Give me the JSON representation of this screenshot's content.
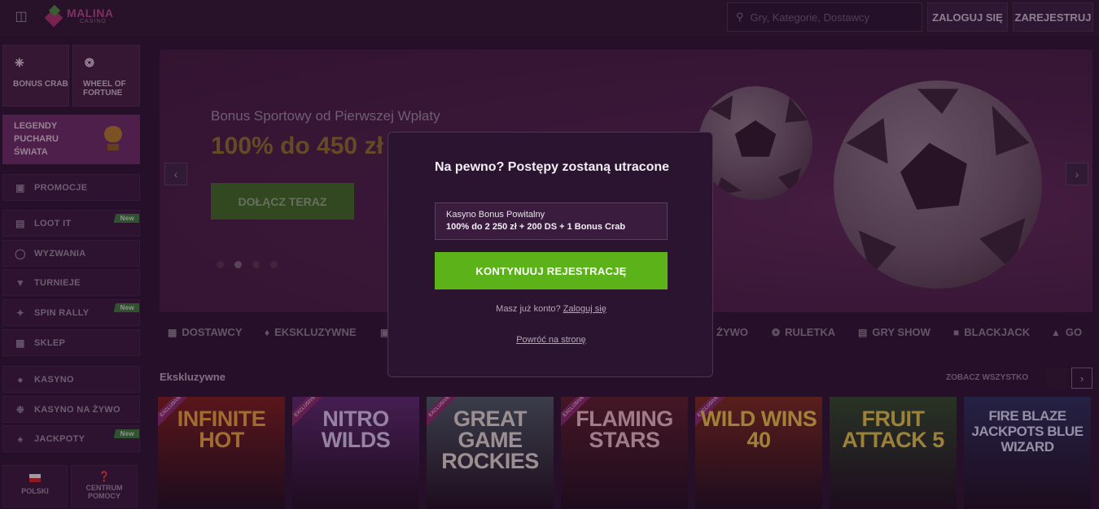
{
  "topbar": {
    "brand": "MALINA",
    "brand_sub": "CASINO",
    "search_placeholder": "Gry, Kategorie, Dostawcy",
    "login_label": "ZALOGUJ SIĘ",
    "register_label": "ZAREJESTRUJ"
  },
  "sidebar": {
    "tiles": [
      {
        "label": "BONUS CRAB",
        "icon": "crab-claw-icon"
      },
      {
        "label": "WHEEL OF FORTUNE",
        "icon": "wheel-icon"
      }
    ],
    "legend": {
      "label": "LEGENDY PUCHARU ŚWIATA",
      "icon": "trophy-icon"
    },
    "items": [
      {
        "label": "PROMOCJE",
        "icon": "gift-icon",
        "badge": ""
      },
      {
        "label": "LOOT IT",
        "icon": "chart-icon",
        "badge": "New"
      },
      {
        "label": "WYZWANIA",
        "icon": "medal-icon",
        "badge": ""
      },
      {
        "label": "TURNIEJE",
        "icon": "trophy-icon",
        "badge": ""
      },
      {
        "label": "SPIN RALLY",
        "icon": "flag-icon",
        "badge": "New"
      },
      {
        "label": "SKLEP",
        "icon": "store-icon",
        "badge": ""
      },
      {
        "label": "KASYNO",
        "icon": "dice-icon",
        "badge": ""
      },
      {
        "label": "KASYNO NA ŻYWO",
        "icon": "chip-icon",
        "badge": ""
      },
      {
        "label": "JACKPOTY",
        "icon": "crown-icon",
        "badge": "New"
      }
    ],
    "language_label": "POLSKI",
    "help_label": "CENTRUM POMOCY"
  },
  "hero": {
    "subtitle": "Bonus Sportowy od Pierwszej Wpłaty",
    "title": "100% do 450 zł",
    "cta_label": "DOŁĄCZ TERAZ",
    "prev_label": "‹",
    "next_label": "›"
  },
  "categories": [
    {
      "label": "DOSTAWCY",
      "icon": "grid-icon"
    },
    {
      "label": "EKSKLUZYWNE",
      "icon": "diamond-icon"
    },
    {
      "label": "",
      "icon": "slots-icon"
    },
    {
      "label": "ŻYWO",
      "icon": ""
    },
    {
      "label": "RULETKA",
      "icon": "roulette-icon"
    },
    {
      "label": "GRY SHOW",
      "icon": "show-icon"
    },
    {
      "label": "BLACKJACK",
      "icon": "card-icon"
    },
    {
      "label": "GO",
      "icon": "fire-icon"
    }
  ],
  "section": {
    "title": "Ekskluzywne",
    "see_all": "ZOBACZ WSZYSTKO",
    "next_label": "›"
  },
  "games": [
    {
      "title": "INFINITE HOT",
      "badge": "EXCLUSIVE",
      "color": "#7a1e1a",
      "text_color": "#e8a23a"
    },
    {
      "title": "NITRO WILDS",
      "badge": "EXCLUSIVE",
      "color": "#5b2a6e",
      "text_color": "#d7c3ea"
    },
    {
      "title": "GREAT GAME ROCKIES",
      "badge": "EXCLUSIVE",
      "color": "#4b5a63",
      "text_color": "#e0d8cf"
    },
    {
      "title": "FLAMING STARS",
      "badge": "EXCLUSIVE",
      "color": "#5a1f2a",
      "text_color": "#e8b9c0"
    },
    {
      "title": "WILD WINS 40",
      "badge": "EXCLUSIVE",
      "color": "#7a2a1c",
      "text_color": "#e8c24a"
    },
    {
      "title": "FRUIT ATTACK 5",
      "badge": "",
      "color": "#2f4a2a",
      "text_color": "#e0c24a"
    },
    {
      "title": "FIRE BLAZE JACKPOTS BLUE WIZARD",
      "badge": "",
      "color": "#2a2f5a",
      "text_color": "#d8d8f0"
    }
  ],
  "modal": {
    "title": "Na pewno? Postępy zostaną utracone",
    "bonus_name": "Kasyno Bonus Powitalny",
    "bonus_value": "100% do 2 250 zł + 200 DS + 1 Bonus Crab",
    "cta_label": "KONTYNUUJ REJESTRACJĘ",
    "login_prompt": "Masz już konto?",
    "login_link": "Zaloguj się",
    "back_link": "Powróć na stronę"
  }
}
